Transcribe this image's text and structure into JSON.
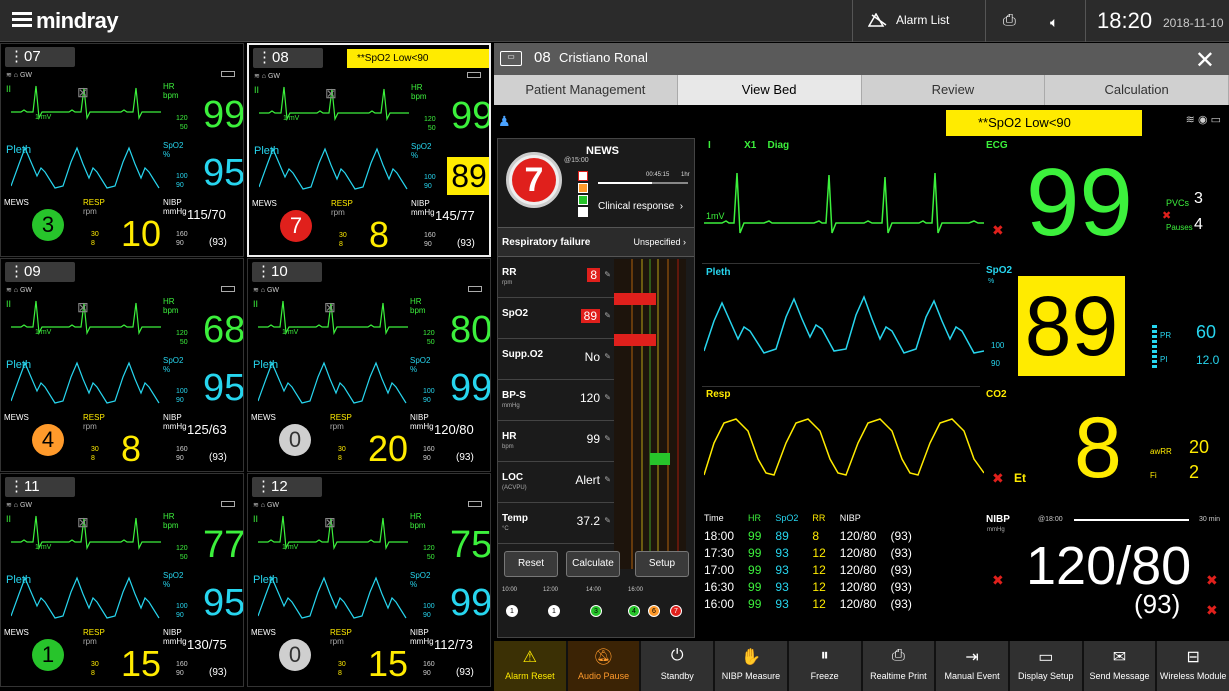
{
  "topbar": {
    "logo": "mindray",
    "alarm_list": "Alarm List",
    "time": "18:20",
    "date": "2018-11-10"
  },
  "tiles": [
    {
      "bed": "07",
      "alarm": "",
      "hr": "99",
      "spo2": "95",
      "mews": "3",
      "mews_color": "#27c42b",
      "resp": "10",
      "nibp": "115/70",
      "map": "(93)",
      "spo2_alarm": false,
      "selected": false
    },
    {
      "bed": "08",
      "alarm": "**SpO2 Low<90",
      "hr": "99",
      "spo2": "89",
      "mews": "7",
      "mews_color": "#e0201c",
      "resp": "8",
      "nibp": "145/77",
      "map": "(93)",
      "spo2_alarm": true,
      "selected": true
    },
    {
      "bed": "09",
      "alarm": "",
      "hr": "68",
      "spo2": "95",
      "mews": "4",
      "mews_color": "#ff9a2b",
      "resp": "8",
      "nibp": "125/63",
      "map": "(93)",
      "spo2_alarm": false,
      "selected": false
    },
    {
      "bed": "10",
      "alarm": "",
      "hr": "80",
      "spo2": "99",
      "mews": "0",
      "mews_color": "#cfcfcf",
      "resp": "20",
      "nibp": "120/80",
      "map": "(93)",
      "spo2_alarm": false,
      "selected": false
    },
    {
      "bed": "11",
      "alarm": "",
      "hr": "77",
      "spo2": "95",
      "mews": "1",
      "mews_color": "#27c42b",
      "resp": "15",
      "nibp": "130/75",
      "map": "(93)",
      "spo2_alarm": false,
      "selected": false
    },
    {
      "bed": "12",
      "alarm": "",
      "hr": "75",
      "spo2": "99",
      "mews": "0",
      "mews_color": "#cfcfcf",
      "resp": "15",
      "nibp": "112/73",
      "map": "(93)",
      "spo2_alarm": false,
      "selected": false
    }
  ],
  "tile_labels": {
    "gw": "GW",
    "ii": "II",
    "mv": "1 mV",
    "hr": "HR",
    "bpm": "bpm",
    "hr_hi": "120",
    "hr_lo": "50",
    "pleth": "Pleth",
    "spo2": "SpO2",
    "pct": "%",
    "sp_hi": "100",
    "sp_lo": "90",
    "mews": "MEWS",
    "resp": "RESP",
    "rpm": "rpm",
    "rr_hi": "30",
    "rr_lo": "8",
    "nibp": "NIBP",
    "mmhg": "mmHg",
    "bp_hi": "160",
    "bp_lo": "90"
  },
  "detail": {
    "bed": "08",
    "patient": "Cristiano Ronal",
    "tabs": [
      "Patient Management",
      "View Bed",
      "Review",
      "Calculation"
    ],
    "alarm": "**SpO2 Low<90",
    "ecg": {
      "lead": "I",
      "gain": "X1",
      "mode": "Diag",
      "label": "ECG",
      "mv": "1mV",
      "hr": "99",
      "pvcs_label": "PVCs",
      "pvcs": "3",
      "pauses_label": "Pauses",
      "pauses": "4"
    },
    "spo2": {
      "wave": "Pleth",
      "label": "SpO2",
      "unit": "%",
      "value": "89",
      "hi": "100",
      "lo": "90",
      "pr_label": "PR",
      "pr": "60",
      "pi_label": "PI",
      "pi": "12.0"
    },
    "co2": {
      "wave": "Resp",
      "label": "CO2",
      "value": "8",
      "awrr_label": "awRR",
      "awrr": "20",
      "fi_label": "Fi",
      "fi": "2",
      "et": "Et"
    },
    "nibp": {
      "label": "NIBP",
      "unit": "mmHg",
      "at": "@18:00",
      "value": "120/80",
      "map": "(93)",
      "dur": "30 min"
    },
    "trend": {
      "headers": [
        "Time",
        "HR",
        "SpO2",
        "RR",
        "NIBP",
        ""
      ],
      "rows": [
        [
          "18:00",
          "99",
          "89",
          "8",
          "120/80",
          "(93)"
        ],
        [
          "17:30",
          "99",
          "93",
          "12",
          "120/80",
          "(93)"
        ],
        [
          "17:00",
          "99",
          "93",
          "12",
          "120/80",
          "(93)"
        ],
        [
          "16:30",
          "99",
          "93",
          "12",
          "120/80",
          "(93)"
        ],
        [
          "16:00",
          "99",
          "93",
          "12",
          "120/80",
          "(93)"
        ]
      ]
    },
    "news": {
      "title": "NEWS",
      "score": "7",
      "at": "@15:00",
      "elapsed": "00:45:15",
      "interval": "1hr",
      "clinical": "Clinical response",
      "resp_failure": "Respiratory failure",
      "spec": "Unspecified",
      "rows": [
        {
          "name": "RR",
          "unit": "rpm",
          "value": "8",
          "score": "3",
          "red": true
        },
        {
          "name": "SpO2",
          "unit": "",
          "value": "89",
          "score": "3",
          "red": true
        },
        {
          "name": "Supp.O2",
          "unit": "",
          "value": "No",
          "score": "0",
          "red": false
        },
        {
          "name": "BP-S",
          "unit": "mmHg",
          "value": "120",
          "score": "0",
          "red": false
        },
        {
          "name": "HR",
          "unit": "bpm",
          "value": "99",
          "score": "1",
          "red": false
        },
        {
          "name": "LOC",
          "unit": "(ACVPU)",
          "value": "Alert",
          "score": "0",
          "red": false
        },
        {
          "name": "Temp",
          "unit": "°C",
          "value": "37.2",
          "score": "0",
          "red": false
        }
      ],
      "buttons": [
        "Reset",
        "Calculate",
        "Setup"
      ],
      "axis": [
        "10:00",
        "12:00",
        "14:00",
        "16:00"
      ],
      "history": [
        {
          "v": "1",
          "c": "#ffffff"
        },
        {
          "v": "1",
          "c": "#ffffff"
        },
        {
          "v": "3",
          "c": "#27c42b"
        },
        {
          "v": "4",
          "c": "#27c42b"
        },
        {
          "v": "6",
          "c": "#ff9a2b"
        },
        {
          "v": "7",
          "c": "#e0201c"
        }
      ]
    },
    "bottom": [
      "Alarm Reset",
      "Audio Pause",
      "Standby",
      "NIBP Measure",
      "Freeze",
      "Realtime Print",
      "Manual Event",
      "Display Setup",
      "Send Message",
      "Wireless Module"
    ]
  },
  "colors": {
    "hr": "#3cf03c",
    "spo2": "#27d5ee",
    "resp": "#ffeb00",
    "alarm": "#ffeb00",
    "white": "#ffffff"
  }
}
